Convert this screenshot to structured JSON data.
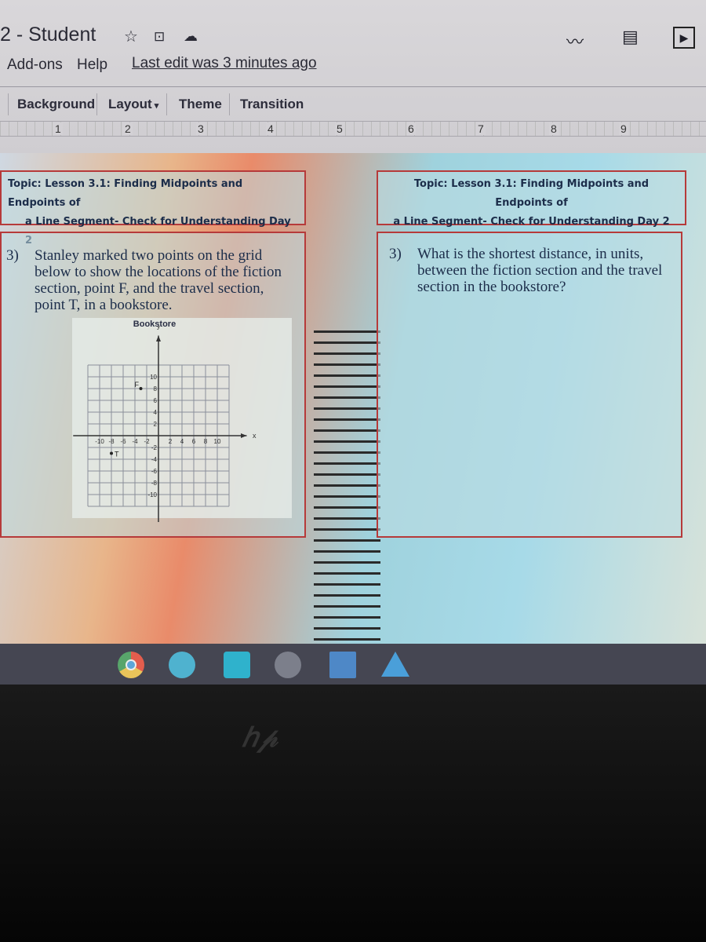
{
  "header": {
    "title": "2 - Student",
    "icons": [
      "star-icon",
      "move-to-folder-icon",
      "cloud-saved-icon"
    ],
    "menu": [
      "Add-ons",
      "Help"
    ],
    "last_edit": "Last edit was 3 minutes ago",
    "right_icons": [
      "activity-trend-icon",
      "comments-icon",
      "present-icon"
    ]
  },
  "toolbar": {
    "background": "Background",
    "layout": "Layout",
    "theme": "Theme",
    "transition": "Transition"
  },
  "ruler": [
    "1",
    "2",
    "3",
    "4",
    "5",
    "6",
    "7",
    "8",
    "9"
  ],
  "slide": {
    "left": {
      "topic_line1": "Topic: Lesson 3.1: Finding Midpoints and Endpoints of",
      "topic_line2": "a Line Segment- Check for Understanding Day 2",
      "qnum": "3)",
      "question": "Stanley marked two points on the grid below to show the locations of the fiction section, point F, and the travel section, point T, in a bookstore.",
      "graph": {
        "title": "Bookstore",
        "xlabel": "x",
        "ylabel": "y",
        "range": [
          -10,
          10
        ],
        "xticks": [
          "-10",
          "-8",
          "-6",
          "-4",
          "-2",
          "2",
          "4",
          "6",
          "8",
          "10"
        ],
        "yticks": [
          "10",
          "8",
          "6",
          "4",
          "2",
          "-2",
          "-4",
          "-6",
          "-8",
          "-10"
        ],
        "points": [
          {
            "label": "F",
            "x": -3,
            "y": 8
          },
          {
            "label": "T",
            "x": -8,
            "y": -3
          }
        ]
      }
    },
    "right": {
      "topic_line1": "Topic: Lesson 3.1: Finding Midpoints and Endpoints of",
      "topic_line2": "a Line Segment- Check for Understanding Day 2",
      "qnum": "3)",
      "question": "What is the shortest distance, in units, between the fiction section and the travel section in the bookstore?"
    }
  },
  "taskbar": {
    "apps": [
      "chrome-icon",
      "video-call-icon",
      "dots-app-icon",
      "camera-icon",
      "game-app-icon",
      "google-drive-icon"
    ]
  },
  "bezel": {
    "logo": "hp"
  }
}
